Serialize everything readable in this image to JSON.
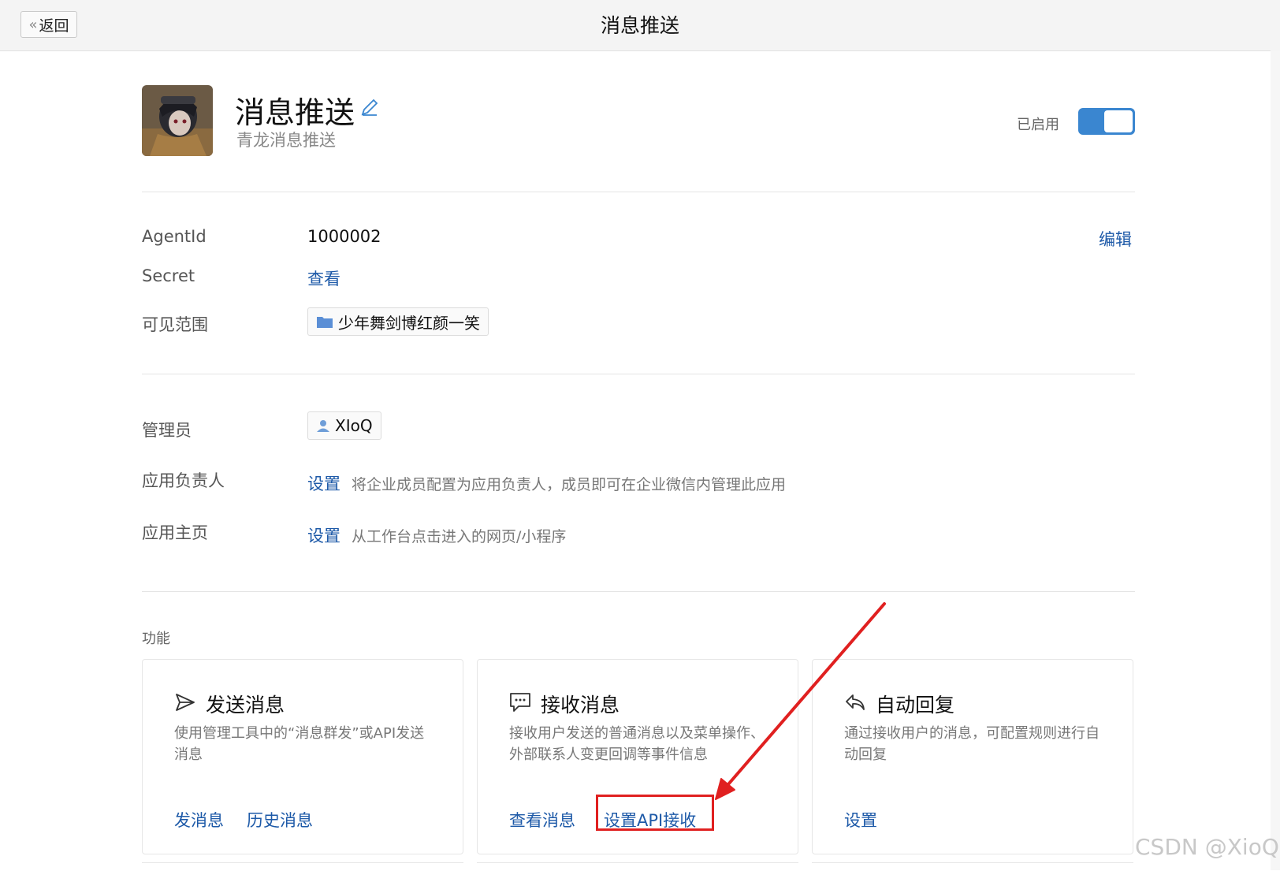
{
  "header": {
    "back_label": "返回",
    "title": "消息推送"
  },
  "app": {
    "name": "消息推送",
    "description": "青龙消息推送",
    "status_label": "已启用",
    "enabled": true
  },
  "details": {
    "agentid_label": "AgentId",
    "agentid_value": "1000002",
    "edit_label": "编辑",
    "secret_label": "Secret",
    "secret_view": "查看",
    "visibility_label": "可见范围",
    "visibility_value": "少年舞剑博红颜一笑"
  },
  "admin": {
    "admin_label": "管理员",
    "admin_value": "XIoQ",
    "owner_label": "应用负责人",
    "owner_action": "设置",
    "owner_hint": "将企业成员配置为应用负责人，成员即可在企业微信内管理此应用",
    "homepage_label": "应用主页",
    "homepage_action": "设置",
    "homepage_hint": "从工作台点击进入的网页/小程序"
  },
  "features": {
    "section_title": "功能",
    "cards": [
      {
        "icon": "send-icon",
        "title": "发送消息",
        "desc": "使用管理工具中的“消息群发”或API发送消息",
        "links": [
          "发消息",
          "历史消息"
        ]
      },
      {
        "icon": "chat-bubble-icon",
        "title": "接收消息",
        "desc": "接收用户发送的普通消息以及菜单操作、外部联系人变更回调等事件信息",
        "links": [
          "查看消息",
          "设置API接收"
        ]
      },
      {
        "icon": "reply-icon",
        "title": "自动回复",
        "desc": "通过接收用户的消息，可配置规则进行自动回复",
        "links": [
          "设置"
        ]
      }
    ]
  },
  "annotation": {
    "color": "#e02020"
  },
  "watermark": "CSDN @XioQ",
  "colors": {
    "link": "#1e5aa8",
    "toggle": "#3a86d0"
  }
}
